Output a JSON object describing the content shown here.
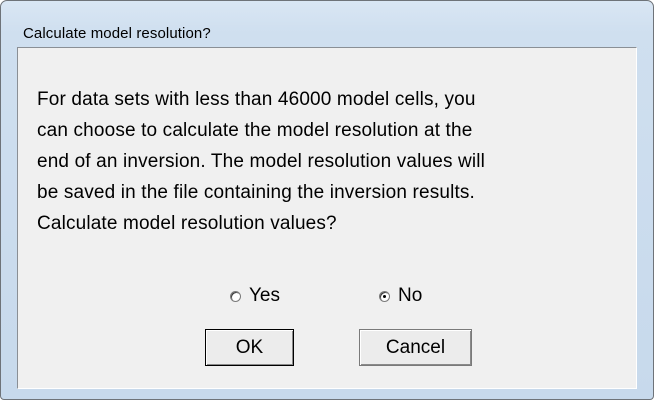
{
  "window": {
    "title": "Calculate model resolution?"
  },
  "message": {
    "lines": [
      "For data sets with less than 46000 model cells, you",
      "can choose to calculate the model resolution at the",
      "end of an inversion. The model resolution values will",
      "be saved in the file containing the inversion results.",
      "Calculate model resolution values?"
    ]
  },
  "options": {
    "yes_label": "Yes",
    "no_label": "No",
    "selected": "No"
  },
  "buttons": {
    "ok_label": "OK",
    "cancel_label": "Cancel"
  }
}
